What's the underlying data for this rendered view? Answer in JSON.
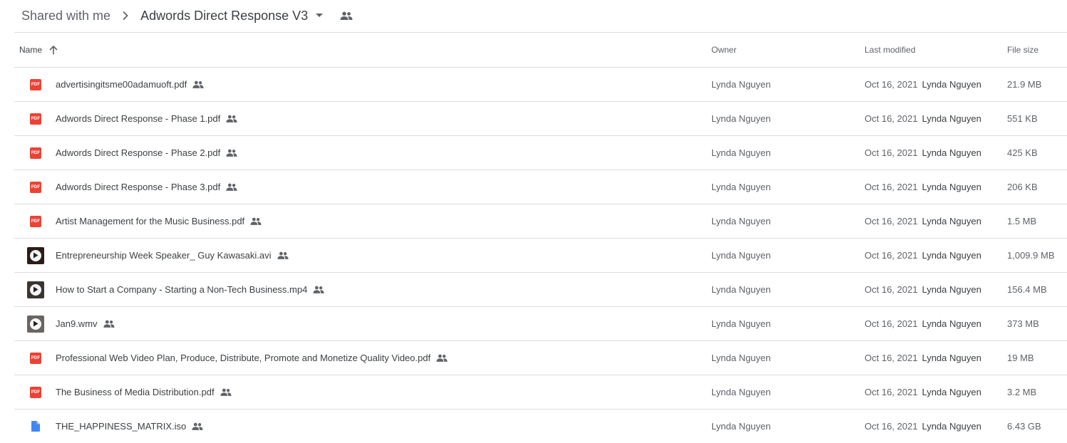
{
  "breadcrumb": {
    "root": "Shared with me",
    "current": "Adwords Direct Response V3"
  },
  "columns": {
    "name": "Name",
    "owner": "Owner",
    "last_modified": "Last modified",
    "file_size": "File size"
  },
  "files": [
    {
      "name": "advertisingitsme00adamuoft.pdf",
      "type": "pdf",
      "owner": "Lynda Nguyen",
      "modified": "Oct 16, 2021",
      "modified_by": "Lynda Nguyen",
      "size": "21.9 MB"
    },
    {
      "name": "Adwords Direct Response - Phase 1.pdf",
      "type": "pdf",
      "owner": "Lynda Nguyen",
      "modified": "Oct 16, 2021",
      "modified_by": "Lynda Nguyen",
      "size": "551 KB"
    },
    {
      "name": "Adwords Direct Response - Phase 2.pdf",
      "type": "pdf",
      "owner": "Lynda Nguyen",
      "modified": "Oct 16, 2021",
      "modified_by": "Lynda Nguyen",
      "size": "425 KB"
    },
    {
      "name": "Adwords Direct Response - Phase 3.pdf",
      "type": "pdf",
      "owner": "Lynda Nguyen",
      "modified": "Oct 16, 2021",
      "modified_by": "Lynda Nguyen",
      "size": "206 KB"
    },
    {
      "name": "Artist Management for the Music Business.pdf",
      "type": "pdf",
      "owner": "Lynda Nguyen",
      "modified": "Oct 16, 2021",
      "modified_by": "Lynda Nguyen",
      "size": "1.5 MB"
    },
    {
      "name": "Entrepreneurship Week Speaker_ Guy Kawasaki.avi",
      "type": "video",
      "owner": "Lynda Nguyen",
      "modified": "Oct 16, 2021",
      "modified_by": "Lynda Nguyen",
      "size": "1,009.9 MB"
    },
    {
      "name": "How to Start a Company - Starting a Non-Tech Business.mp4",
      "type": "video",
      "owner": "Lynda Nguyen",
      "modified": "Oct 16, 2021",
      "modified_by": "Lynda Nguyen",
      "size": "156.4 MB"
    },
    {
      "name": "Jan9.wmv",
      "type": "video",
      "owner": "Lynda Nguyen",
      "modified": "Oct 16, 2021",
      "modified_by": "Lynda Nguyen",
      "size": "373 MB"
    },
    {
      "name": "Professional Web Video Plan, Produce, Distribute, Promote and Monetize Quality Video.pdf",
      "type": "pdf",
      "owner": "Lynda Nguyen",
      "modified": "Oct 16, 2021",
      "modified_by": "Lynda Nguyen",
      "size": "19 MB"
    },
    {
      "name": "The Business of Media Distribution.pdf",
      "type": "pdf",
      "owner": "Lynda Nguyen",
      "modified": "Oct 16, 2021",
      "modified_by": "Lynda Nguyen",
      "size": "3.2 MB"
    },
    {
      "name": "THE_HAPPINESS_MATRIX.iso",
      "type": "file",
      "owner": "Lynda Nguyen",
      "modified": "Oct 16, 2021",
      "modified_by": "Lynda Nguyen",
      "size": "6.43 GB"
    }
  ],
  "icons": {
    "pdf_label": "PDF",
    "pdf_color": "#ea4335",
    "generic_file_color": "#4285f4",
    "shared_icon_color": "#5f6368"
  }
}
